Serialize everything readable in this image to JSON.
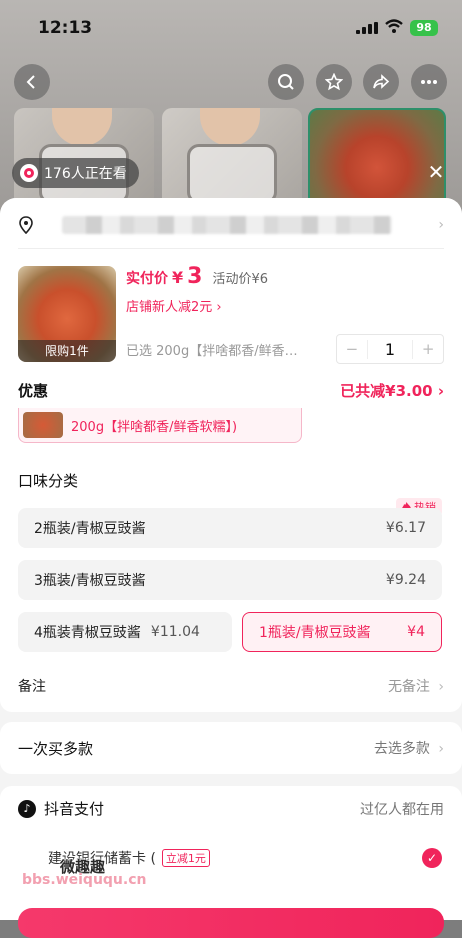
{
  "status_bar": {
    "time": "12:13",
    "battery": "98"
  },
  "background": {
    "watching_text": "176人正在看"
  },
  "product": {
    "pay_label": "实付价",
    "pay_currency": "¥",
    "pay_value": "3",
    "activity_price": "活动价¥6",
    "new_customer": "店铺新人减2元",
    "limit_label": "限购1件",
    "selected_text": "已选 200g【拌啥都香/鲜香…",
    "quantity": "1",
    "qty_minus": "−",
    "qty_plus": "+"
  },
  "discount": {
    "title": "优惠",
    "total": "已共减¥3.00"
  },
  "previous_selection": "200g【拌啥都香/鲜香软糯】)",
  "flavor": {
    "title": "口味分类",
    "hot_badge": "热销",
    "options": [
      {
        "label": "2瓶装/青椒豆豉酱",
        "price": "¥6.17"
      },
      {
        "label": "3瓶装/青椒豆豉酱",
        "price": "¥9.24"
      },
      {
        "label": "4瓶装青椒豆豉酱",
        "price": "¥11.04"
      },
      {
        "label": "1瓶装/青椒豆豉酱",
        "price": "¥4"
      }
    ],
    "selected_index": 3
  },
  "note": {
    "label": "备注",
    "value": "无备注"
  },
  "multi_buy": {
    "label": "一次买多款",
    "action": "去选多款"
  },
  "payment": {
    "title": "抖音支付",
    "subtitle": "过亿人都在用",
    "bank": "建设银行储蓄卡 (",
    "bank_tag": "立减1元"
  },
  "watermark": {
    "url": "bbs.weiququ.cn",
    "cn": "微趣趣"
  },
  "colors": {
    "accent": "#f0245b",
    "selected_bg": "#fff1f4"
  }
}
